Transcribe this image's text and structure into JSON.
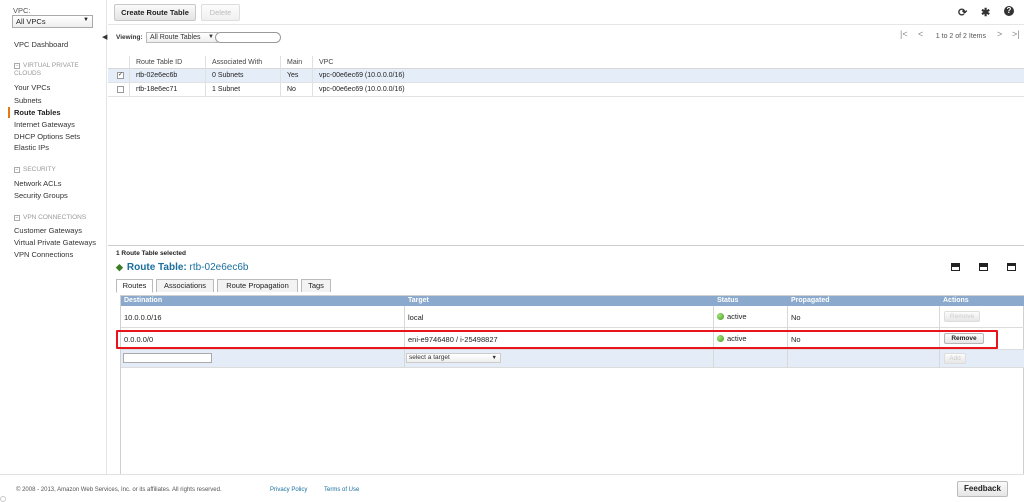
{
  "sidebar": {
    "vpc_label": "VPC:",
    "vpc_selected": "All VPCs",
    "dashboard": "VPC Dashboard",
    "section_vpc": {
      "line1": "VIRTUAL PRIVATE",
      "line2": "CLOUDS"
    },
    "vpc_items": [
      "Your VPCs",
      "Subnets",
      "Route Tables",
      "Internet Gateways",
      "DHCP Options Sets",
      "Elastic IPs"
    ],
    "section_security": "SECURITY",
    "security_items": [
      "Network ACLs",
      "Security Groups"
    ],
    "section_vpn": "VPN CONNECTIONS",
    "vpn_items": [
      "Customer Gateways",
      "Virtual Private Gateways",
      "VPN Connections"
    ],
    "active_item": "Route Tables"
  },
  "toolbar": {
    "create_label": "Create Route Table",
    "delete_label": "Delete"
  },
  "filter": {
    "viewing_label": "Viewing:",
    "selected": "All Route Tables",
    "search_value": "",
    "pager_text": "1 to 2 of 2 Items"
  },
  "grid": {
    "columns": [
      "Route Table ID",
      "Associated With",
      "Main",
      "VPC"
    ],
    "rows": [
      {
        "checked": true,
        "id": "rtb-02e6ec6b",
        "associated": "0 Subnets",
        "main": "Yes",
        "vpc": "vpc-00e6ec69 (10.0.0.0/16)"
      },
      {
        "checked": false,
        "id": "rtb-18e6ec71",
        "associated": "1 Subnet",
        "main": "No",
        "vpc": "vpc-00e6ec69 (10.0.0.0/16)"
      }
    ]
  },
  "details": {
    "selected_count": "1 Route Table selected",
    "title_label": "Route Table:",
    "title_id": "rtb-02e6ec6b",
    "tabs": [
      "Routes",
      "Associations",
      "Route Propagation",
      "Tags"
    ],
    "active_tab": "Routes",
    "routes_columns": [
      "Destination",
      "Target",
      "Status",
      "Propagated",
      "Actions"
    ],
    "routes": [
      {
        "destination": "10.0.0.0/16",
        "target": "local",
        "status": "active",
        "propagated": "No",
        "action": "Remove",
        "action_enabled": false
      },
      {
        "destination": "0.0.0.0/0",
        "target": "eni-e9746480 / i-25498827",
        "status": "active",
        "propagated": "No",
        "action": "Remove",
        "action_enabled": true
      }
    ],
    "new_route": {
      "destination_value": "",
      "target_placeholder": "select a target",
      "add_label": "Add"
    }
  },
  "footer": {
    "copyright": "© 2008 - 2013, Amazon Web Services, Inc. or its affiliates. All rights reserved.",
    "privacy": "Privacy Policy",
    "terms": "Terms of Use",
    "feedback": "Feedback"
  },
  "colors": {
    "accent_blue": "#1a6f9e",
    "header_blue": "#8aa9cc",
    "status_green": "#3e9c1c",
    "highlight_red": "#e8141b",
    "active_orange": "#e47911"
  }
}
